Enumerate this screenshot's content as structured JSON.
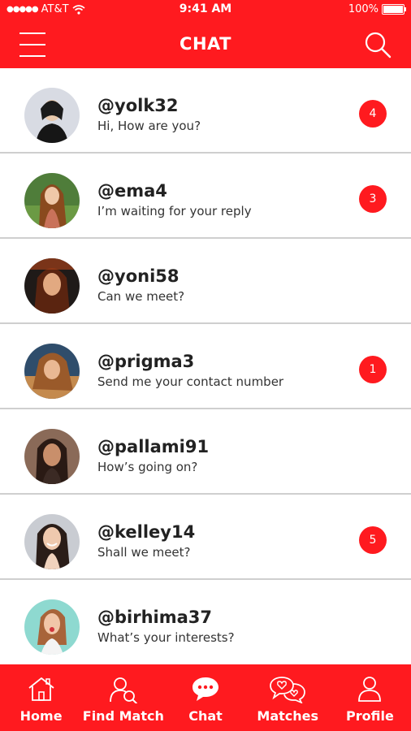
{
  "colors": {
    "accent": "#ff1a1f"
  },
  "status_bar": {
    "carrier": "AT&T",
    "time": "9:41 AM",
    "battery": "100%"
  },
  "header": {
    "title": "CHAT",
    "menu_icon": "hamburger-icon",
    "search_icon": "search-icon"
  },
  "chats": [
    {
      "username": "@yolk32",
      "message": "Hi, How are you?",
      "unread": "4"
    },
    {
      "username": "@ema4",
      "message": "I’m waiting for your reply",
      "unread": "3"
    },
    {
      "username": "@yoni58",
      "message": "Can we meet?",
      "unread": ""
    },
    {
      "username": "@prigma3",
      "message": "Send me your contact number",
      "unread": "1"
    },
    {
      "username": "@pallami91",
      "message": "How’s going on?",
      "unread": ""
    },
    {
      "username": "@kelley14",
      "message": "Shall we meet?",
      "unread": "5"
    },
    {
      "username": "@birhima37",
      "message": "What’s your interests?",
      "unread": ""
    }
  ],
  "bottom_nav": [
    {
      "label": "Home",
      "icon": "home-icon"
    },
    {
      "label": "Find Match",
      "icon": "find-match-icon"
    },
    {
      "label": "Chat",
      "icon": "chat-icon"
    },
    {
      "label": "Matches",
      "icon": "matches-icon"
    },
    {
      "label": "Profile",
      "icon": "profile-icon"
    }
  ]
}
